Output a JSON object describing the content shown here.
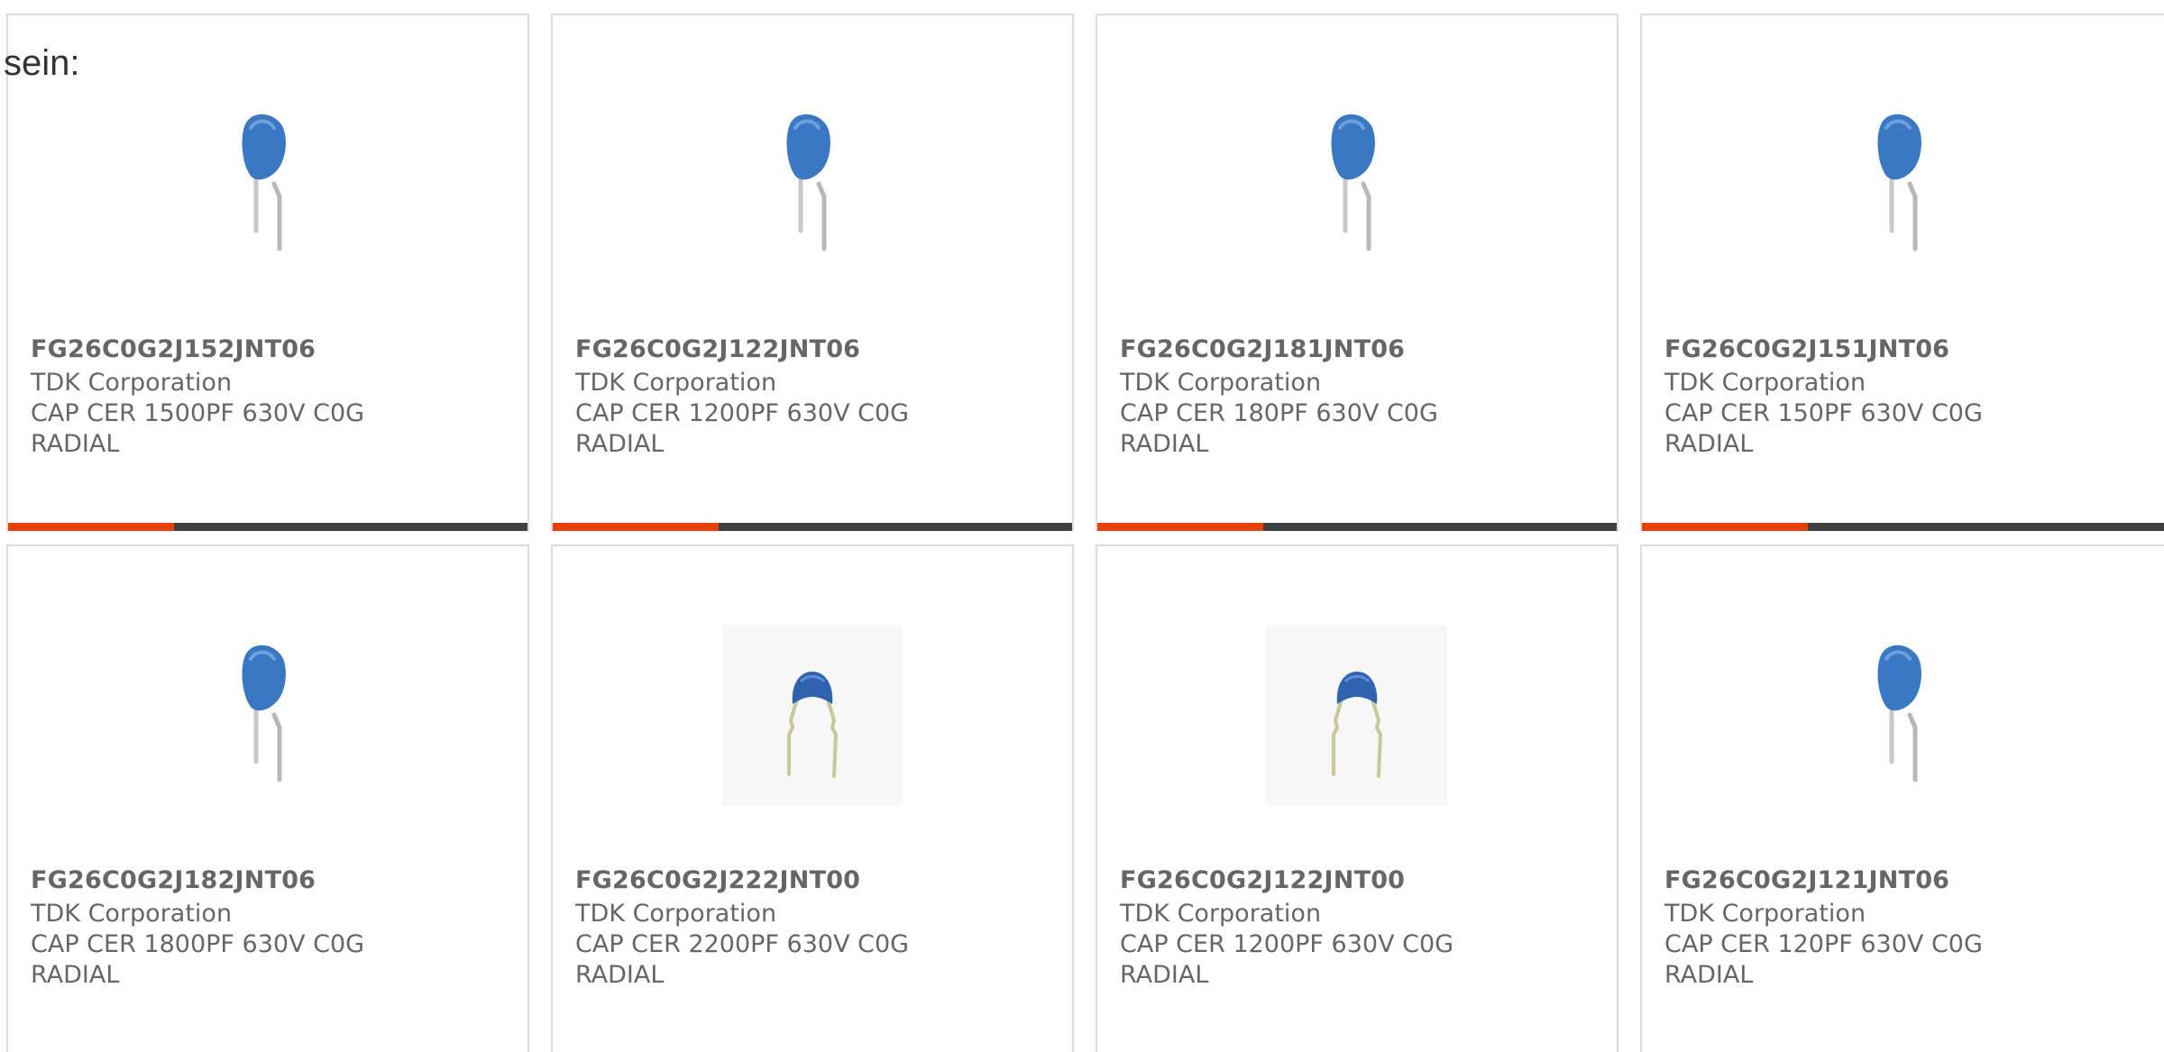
{
  "heading_fragment": "sein:",
  "colors": {
    "accent": "#e8400c",
    "bar": "#404040",
    "card_border": "#dcdcdc",
    "text": "#666666",
    "capacitor_blue": "#3a78c4"
  },
  "cards": [
    {
      "part": "FG26C0G2J152JNT06",
      "manufacturer": "TDK Corporation",
      "description": "CAP CER 1500PF 630V C0G RADIAL",
      "image": "disc-capacitor-tall-icon"
    },
    {
      "part": "FG26C0G2J122JNT06",
      "manufacturer": "TDK Corporation",
      "description": "CAP CER 1200PF 630V C0G RADIAL",
      "image": "disc-capacitor-tall-icon"
    },
    {
      "part": "FG26C0G2J181JNT06",
      "manufacturer": "TDK Corporation",
      "description": "CAP CER 180PF 630V C0G RADIAL",
      "image": "disc-capacitor-tall-icon"
    },
    {
      "part": "FG26C0G2J151JNT06",
      "manufacturer": "TDK Corporation",
      "description": "CAP CER 150PF 630V C0G RADIAL",
      "image": "disc-capacitor-tall-icon"
    },
    {
      "part": "FG26C0G2J182JNT06",
      "manufacturer": "TDK Corporation",
      "description": "CAP CER 1800PF 630V C0G RADIAL",
      "image": "disc-capacitor-tall-icon"
    },
    {
      "part": "FG26C0G2J222JNT00",
      "manufacturer": "TDK Corporation",
      "description": "CAP CER 2200PF 630V C0G RADIAL",
      "image": "disc-capacitor-kinked-icon"
    },
    {
      "part": "FG26C0G2J122JNT00",
      "manufacturer": "TDK Corporation",
      "description": "CAP CER 1200PF 630V C0G RADIAL",
      "image": "disc-capacitor-kinked-icon"
    },
    {
      "part": "FG26C0G2J121JNT06",
      "manufacturer": "TDK Corporation",
      "description": "CAP CER 120PF 630V C0G RADIAL",
      "image": "disc-capacitor-tall-icon"
    }
  ]
}
